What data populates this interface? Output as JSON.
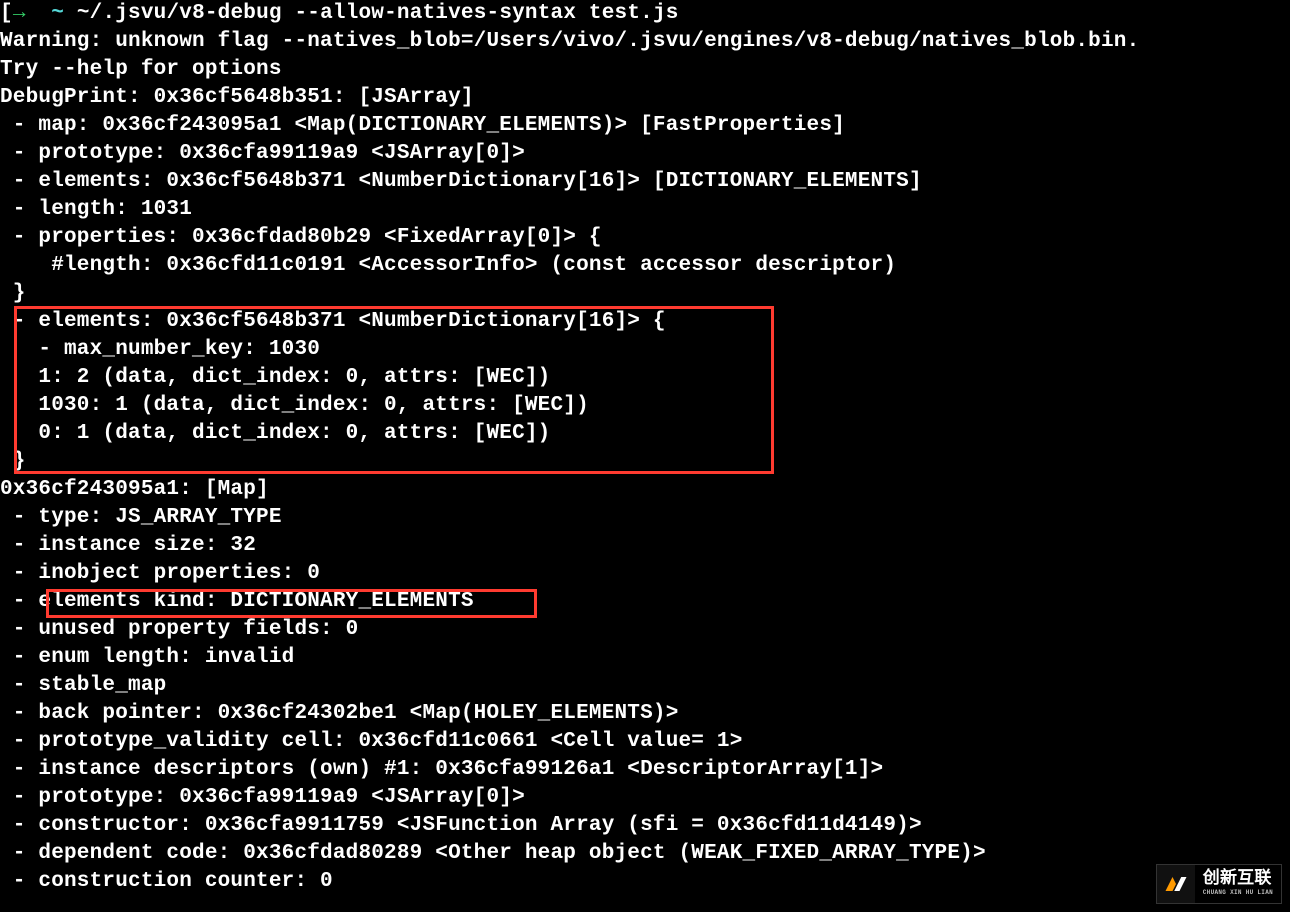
{
  "prompt": {
    "bracket_open": "[",
    "arrow": "→",
    "tilde": "~",
    "command": " ~/.jsvu/v8-debug --allow-natives-syntax test.js"
  },
  "lines": {
    "l1": "Warning: unknown flag --natives_blob=/Users/vivo/.jsvu/engines/v8-debug/natives_blob.bin.",
    "l2": "Try --help for options",
    "l3": "DebugPrint: 0x36cf5648b351: [JSArray]",
    "l4": " - map: 0x36cf243095a1 <Map(DICTIONARY_ELEMENTS)> [FastProperties]",
    "l5": " - prototype: 0x36cfa99119a9 <JSArray[0]>",
    "l6": " - elements: 0x36cf5648b371 <NumberDictionary[16]> [DICTIONARY_ELEMENTS]",
    "l7": " - length: 1031",
    "l8": " - properties: 0x36cfdad80b29 <FixedArray[0]> {",
    "l9": "    #length: 0x36cfd11c0191 <AccessorInfo> (const accessor descriptor)",
    "l10": " }",
    "l11": " - elements: 0x36cf5648b371 <NumberDictionary[16]> {",
    "l12": "   - max_number_key: 1030",
    "l13": "   1: 2 (data, dict_index: 0, attrs: [WEC])",
    "l14": "   1030: 1 (data, dict_index: 0, attrs: [WEC])",
    "l15": "   0: 1 (data, dict_index: 0, attrs: [WEC])",
    "l16": " }",
    "l17": "0x36cf243095a1: [Map]",
    "l18": " - type: JS_ARRAY_TYPE",
    "l19": " - instance size: 32",
    "l20": " - inobject properties: 0",
    "l21": " - elements kind: DICTIONARY_ELEMENTS",
    "l22": " - unused property fields: 0",
    "l23": " - enum length: invalid",
    "l24": " - stable_map",
    "l25": " - back pointer: 0x36cf24302be1 <Map(HOLEY_ELEMENTS)>",
    "l26": " - prototype_validity cell: 0x36cfd11c0661 <Cell value= 1>",
    "l27": " - instance descriptors (own) #1: 0x36cfa99126a1 <DescriptorArray[1]>",
    "l28": " - prototype: 0x36cfa99119a9 <JSArray[0]>",
    "l29": " - constructor: 0x36cfa9911759 <JSFunction Array (sfi = 0x36cfd11d4149)>",
    "l30": " - dependent code: 0x36cfdad80289 <Other heap object (WEAK_FIXED_ARRAY_TYPE)>",
    "l31": " - construction counter: 0"
  },
  "watermark": {
    "cn": "创新互联",
    "en": "CHUANG XIN HU LIAN"
  }
}
